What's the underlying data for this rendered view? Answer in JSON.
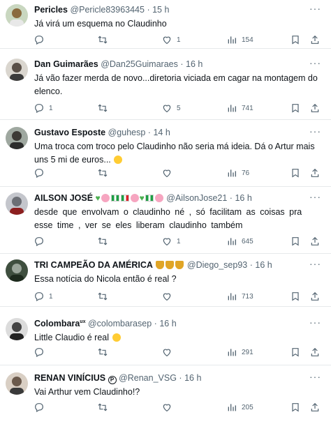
{
  "tweets": [
    {
      "name": "Pericles",
      "handle": "@Pericle83963445",
      "time": "15 h",
      "text": "Já virá um esquema no Claudinho",
      "reply": "",
      "retweet": "",
      "like": "1",
      "views": "154",
      "avatar_color": "#8a6a3e"
    },
    {
      "name": "Dan Guimarães",
      "handle": "@Dan25Guimaraes",
      "time": "16 h",
      "text": "Já vão fazer merda de novo...diretoria viciada em cagar na montagem do elenco.",
      "reply": "1",
      "retweet": "",
      "like": "5",
      "views": "741",
      "avatar_color": "#5a5048"
    },
    {
      "name": "Gustavo Esposte",
      "handle": "@guhesp",
      "time": "14 h",
      "text": "Uma troca com troco pelo Claudinho não seria má ideia. Dá o Artur mais uns 5 mi de euros...",
      "reply": "",
      "retweet": "",
      "like": "",
      "views": "76",
      "avatar_color": "#3d3a36"
    },
    {
      "name": "AILSON JOSÉ",
      "handle": "@AilsonJose21",
      "time": "16 h",
      "text": "desde que envolvam o claudinho né , só facilitam as coisas pra esse time , ver se eles liberam claudinho também",
      "reply": "",
      "retweet": "",
      "like": "1",
      "views": "645",
      "avatar_color": "#6c6f75"
    },
    {
      "name": "TRI CAMPEÃO DA AMÉRICA",
      "handle": "@Diego_sep93",
      "time": "16 h",
      "text": "Essa notícia do Nicola então é real ?",
      "reply": "1",
      "retweet": "",
      "like": "",
      "views": "713",
      "avatar_color": "#2f3a2f"
    },
    {
      "name": "Colombara",
      "name_suffix": "ux",
      "handle": "@colombarasep",
      "time": "16 h",
      "text": "Little Claudio é real",
      "reply": "",
      "retweet": "",
      "like": "",
      "views": "291",
      "avatar_color": "#444444"
    },
    {
      "name": "RENAN VINÍCIUS",
      "name_badge": "P",
      "handle": "@Renan_VSG",
      "time": "16 h",
      "text": "Vai Arthur vem Claudinho!?",
      "reply": "",
      "retweet": "",
      "like": "",
      "views": "205",
      "avatar_color": "#6b5a4c"
    }
  ],
  "separator": "·",
  "more_label": "···",
  "icons": {
    "reply": "reply-icon",
    "retweet": "retweet-icon",
    "like": "heart-icon",
    "views": "views-icon",
    "bookmark": "bookmark-icon",
    "share": "share-icon"
  }
}
